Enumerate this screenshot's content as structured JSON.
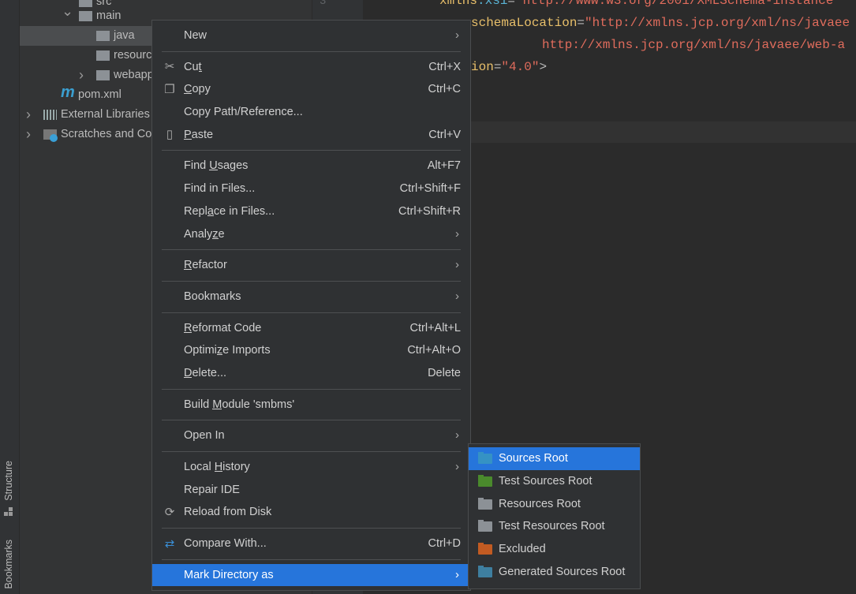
{
  "tool_strip": {
    "structure": "Structure",
    "bookmarks": "Bookmarks"
  },
  "project_tree": [
    {
      "label": "src",
      "icon": "folder-icon"
    },
    {
      "label": "main",
      "icon": "folder-icon",
      "expanded": true
    },
    {
      "label": "java",
      "icon": "folder-icon",
      "selected": true
    },
    {
      "label": "resources",
      "icon": "resources-folder-icon"
    },
    {
      "label": "webapp",
      "icon": "web-folder-icon",
      "collapsed": true
    },
    {
      "label": "pom.xml",
      "icon": "maven-icon"
    },
    {
      "label": "External Libraries",
      "icon": "libraries-icon",
      "collapsed": true
    },
    {
      "label": "Scratches and Consoles",
      "icon": "scratches-icon",
      "collapsed": true
    }
  ],
  "editor": {
    "line_number": "3",
    "lines": [
      {
        "a": "xmlns",
        "b": ":xsi",
        "c": "=",
        "d": "\"http://www.w3.org/2001/XMLSchema-instance\""
      },
      {
        "a": "schemaLocation",
        "c": "=",
        "d": "\"http://xmlns.jcp.org/xml/ns/javaee"
      },
      {
        "d": "http://xmlns.jcp.org/xml/ns/javaee/web-a"
      },
      {
        "a": "ion",
        "c": "=",
        "d": "\"4.0\"",
        "e": ">"
      }
    ]
  },
  "context_menu": [
    {
      "label": "New",
      "submenu": true
    },
    {
      "sep": true
    },
    {
      "label": "Cut",
      "u": "t",
      "shortcut": "Ctrl+X",
      "icon": "scissors-icon"
    },
    {
      "label": "Copy",
      "u": "C",
      "shortcut": "Ctrl+C",
      "icon": "copy-icon"
    },
    {
      "label": "Copy Path/Reference..."
    },
    {
      "label": "Paste",
      "u": "P",
      "shortcut": "Ctrl+V",
      "icon": "paste-icon"
    },
    {
      "sep": true
    },
    {
      "label": "Find Usages",
      "u": "U",
      "shortcut": "Alt+F7"
    },
    {
      "label": "Find in Files...",
      "shortcut": "Ctrl+Shift+F"
    },
    {
      "label": "Replace in Files...",
      "u": "a",
      "shortcut": "Ctrl+Shift+R"
    },
    {
      "label": "Analyze",
      "u": "z",
      "submenu": true
    },
    {
      "sep": true
    },
    {
      "label": "Refactor",
      "u": "R",
      "submenu": true
    },
    {
      "sep": true
    },
    {
      "label": "Bookmarks",
      "submenu": true
    },
    {
      "sep": true
    },
    {
      "label": "Reformat Code",
      "u": "R",
      "shortcut": "Ctrl+Alt+L"
    },
    {
      "label": "Optimize Imports",
      "u": "z",
      "shortcut": "Ctrl+Alt+O"
    },
    {
      "label": "Delete...",
      "u": "D",
      "shortcut": "Delete"
    },
    {
      "sep": true
    },
    {
      "label": "Build Module 'smbms'",
      "u": "M"
    },
    {
      "sep": true
    },
    {
      "label": "Open In",
      "submenu": true
    },
    {
      "sep": true
    },
    {
      "label": "Local History",
      "u": "H",
      "submenu": true
    },
    {
      "label": "Repair IDE"
    },
    {
      "label": "Reload from Disk",
      "icon": "reload-icon"
    },
    {
      "sep": true
    },
    {
      "label": "Compare With...",
      "shortcut": "Ctrl+D",
      "icon": "compare-icon"
    },
    {
      "sep": true
    },
    {
      "label": "Mark Directory as",
      "submenu": true,
      "highlighted": true
    }
  ],
  "mark_submenu": [
    {
      "label": "Sources Root",
      "color": "#3592c4",
      "highlighted": true
    },
    {
      "label": "Test Sources Root",
      "color": "#4a8a2c"
    },
    {
      "label": "Resources Root",
      "color": "#8c9196"
    },
    {
      "label": "Test Resources Root",
      "color": "#8c9196"
    },
    {
      "label": "Excluded",
      "color": "#c25b22"
    },
    {
      "label": "Generated Sources Root",
      "color": "#3e7fa0"
    }
  ],
  "colors": {
    "accent": "#2675db",
    "menu_bg": "#2f3133",
    "string": "#e06c5c",
    "attr": "#e8bf6a"
  }
}
